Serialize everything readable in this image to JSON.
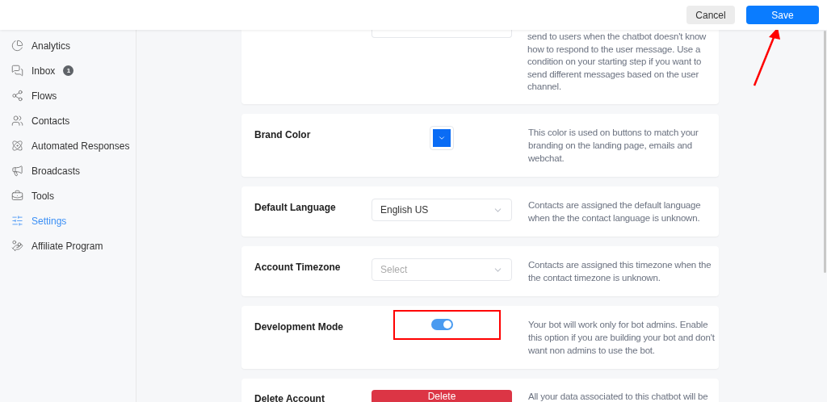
{
  "top_bar": {
    "buttons": [
      {
        "label": "Cancel",
        "kind": "secondary"
      },
      {
        "label": "Save",
        "kind": "primary"
      }
    ]
  },
  "sidebar": {
    "items": [
      {
        "label": "Analytics",
        "selected": false
      },
      {
        "label": "Inbox",
        "selected": false,
        "badge": "1"
      },
      {
        "label": "Flows",
        "selected": false
      },
      {
        "label": "Contacts",
        "selected": false
      },
      {
        "label": "Automated Responses",
        "selected": false
      },
      {
        "label": "Broadcasts",
        "selected": false
      },
      {
        "label": "Tools",
        "selected": false
      },
      {
        "label": "Settings",
        "selected": true
      },
      {
        "label": "Affiliate Program",
        "selected": false
      }
    ]
  },
  "settings": [
    {
      "kind": "partial",
      "description": "send to users when the chatbot doesn't know how to respond to the user message. Use a condition on your starting step if you want to send different messages based on the user channel."
    },
    {
      "kind": "color",
      "label": "Brand Color",
      "color": "#0a6cf5",
      "description": "This color is used on buttons to match your branding on the landing page, emails and webchat."
    },
    {
      "kind": "select",
      "label": "Default Language",
      "value": "English US",
      "description": "Contacts are assigned the default language when the the contact language is unknown."
    },
    {
      "kind": "select",
      "label": "Account Timezone",
      "placeholder": "Select",
      "description": "Contacts are assigned this timezone when the the contact timezone is unknown."
    },
    {
      "kind": "toggle",
      "label": "Development Mode",
      "on": true,
      "description": "Your bot will work only for bot admins. Enable this option if you are building your bot and don't want non admins to use the bot."
    },
    {
      "kind": "danger",
      "label": "Delete Account",
      "button": "Delete",
      "description": "All your data associated to this chatbot will be"
    }
  ]
}
